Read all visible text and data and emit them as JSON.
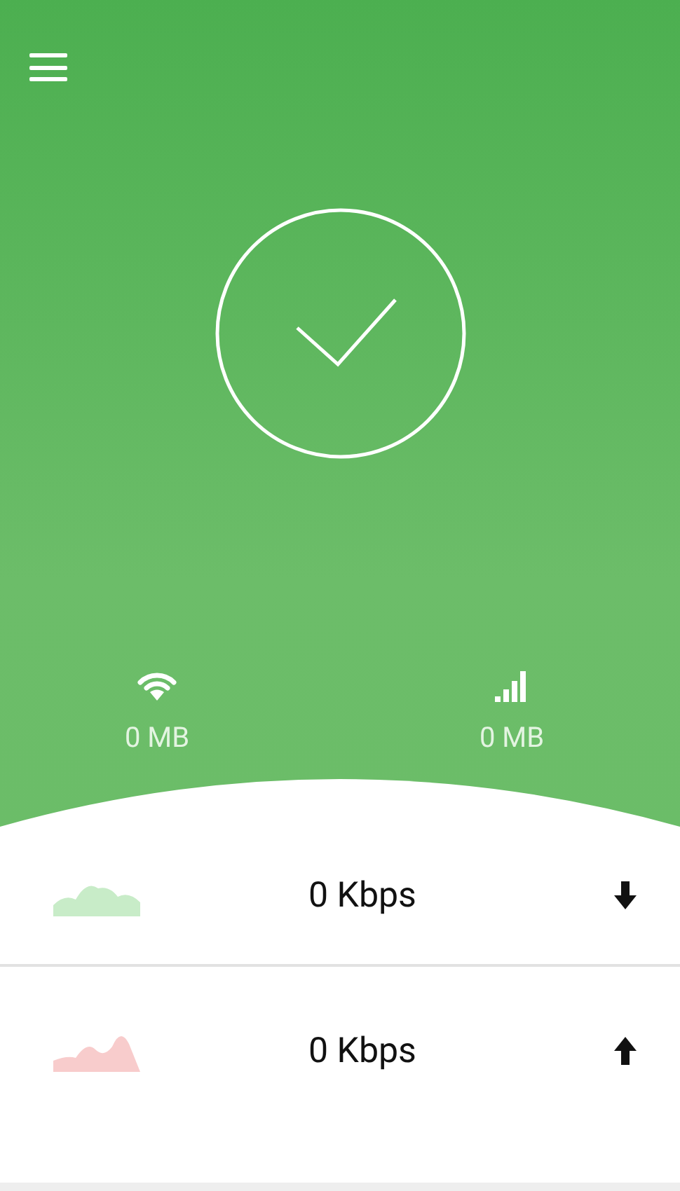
{
  "status": {
    "kind": "connected"
  },
  "usage": [
    {
      "kind": "wifi",
      "value": "0 MB"
    },
    {
      "kind": "cellular",
      "value": "0 MB"
    }
  ],
  "speeds": [
    {
      "kind": "download",
      "value": "0 Kbps",
      "color": "#c8ecc8"
    },
    {
      "kind": "upload",
      "value": "0 Kbps",
      "color": "#f8cccc"
    }
  ]
}
